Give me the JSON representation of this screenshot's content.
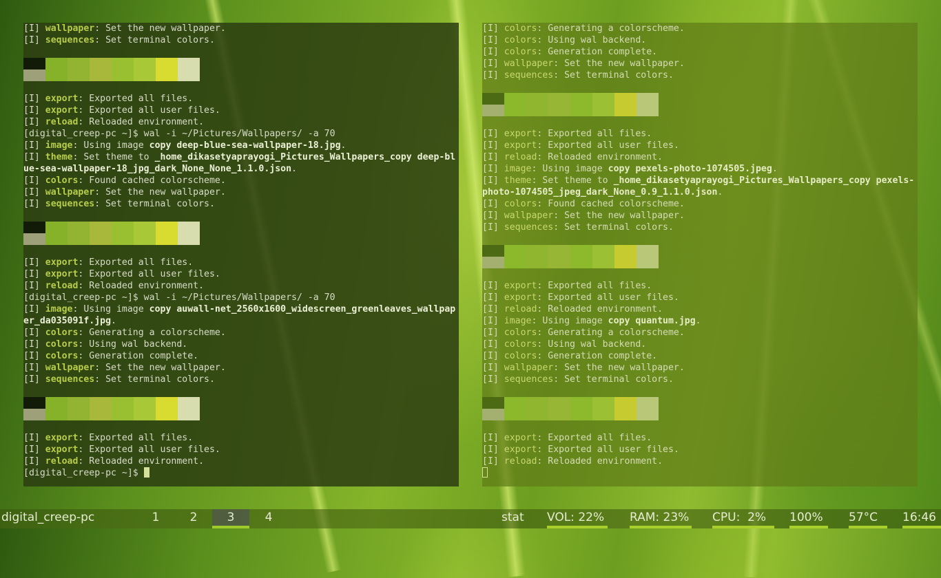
{
  "colors": {
    "accent": "#b8cd4a",
    "workspace_active_underline": "#9ecb2a",
    "stat_underline": "#a8cf2c"
  },
  "terminal_left": {
    "lines": [
      {
        "t": "line",
        "segs": [
          [
            "[I] ",
            ""
          ],
          [
            "wallpaper",
            "tag"
          ],
          [
            ": Set the new wallpaper.",
            ""
          ]
        ]
      },
      {
        "t": "line",
        "segs": [
          [
            "[I] ",
            ""
          ],
          [
            "sequences",
            "tag"
          ],
          [
            ": Set terminal colors.",
            ""
          ]
        ]
      },
      {
        "t": "blank"
      },
      {
        "t": "palette",
        "top": [
          "#121a08",
          "#86b22a",
          "#92b432",
          "#a8b83a",
          "#98c030",
          "#a8c838",
          "#d8dc30",
          "#d8ddb0"
        ],
        "bottom": [
          "#9ea07a",
          "#86b22a",
          "#92b432",
          "#a8b83a",
          "#98c030",
          "#a8c838",
          "#d8dc30",
          "#d8ddb0"
        ]
      },
      {
        "t": "blank"
      },
      {
        "t": "line",
        "segs": [
          [
            "[I] ",
            ""
          ],
          [
            "export",
            "tag"
          ],
          [
            ": Exported all files.",
            ""
          ]
        ]
      },
      {
        "t": "line",
        "segs": [
          [
            "[I] ",
            ""
          ],
          [
            "export",
            "tag"
          ],
          [
            ": Exported all user files.",
            ""
          ]
        ]
      },
      {
        "t": "line",
        "segs": [
          [
            "[I] ",
            ""
          ],
          [
            "reload",
            "tag"
          ],
          [
            ": Reloaded environment.",
            ""
          ]
        ]
      },
      {
        "t": "line",
        "segs": [
          [
            "[digital_creep-pc ~]$ wal -i ~/Pictures/Wallpapers/ -a 70",
            ""
          ]
        ]
      },
      {
        "t": "line",
        "segs": [
          [
            "[I] ",
            ""
          ],
          [
            "image",
            "tag"
          ],
          [
            ": Using image ",
            ""
          ],
          [
            "copy deep-blue-sea-wallpaper-18.jpg",
            "strong"
          ],
          [
            ".",
            ""
          ]
        ]
      },
      {
        "t": "line",
        "segs": [
          [
            "[I] ",
            ""
          ],
          [
            "theme",
            "tag"
          ],
          [
            ": Set theme to ",
            ""
          ],
          [
            "_home_dikasetyaprayogi_Pictures_Wallpapers_copy deep-bl",
            "strong"
          ]
        ]
      },
      {
        "t": "line",
        "segs": [
          [
            "ue-sea-wallpaper-18_jpg_dark_None_None_1.1.0.json",
            "strong"
          ],
          [
            ".",
            ""
          ]
        ]
      },
      {
        "t": "line",
        "segs": [
          [
            "[I] ",
            ""
          ],
          [
            "colors",
            "tag"
          ],
          [
            ": Found cached colorscheme.",
            ""
          ]
        ]
      },
      {
        "t": "line",
        "segs": [
          [
            "[I] ",
            ""
          ],
          [
            "wallpaper",
            "tag"
          ],
          [
            ": Set the new wallpaper.",
            ""
          ]
        ]
      },
      {
        "t": "line",
        "segs": [
          [
            "[I] ",
            ""
          ],
          [
            "sequences",
            "tag"
          ],
          [
            ": Set terminal colors.",
            ""
          ]
        ]
      },
      {
        "t": "blank"
      },
      {
        "t": "palette",
        "top": [
          "#121a08",
          "#86b22a",
          "#92b432",
          "#a8b83a",
          "#98c030",
          "#a8c838",
          "#d8dc30",
          "#d8ddb0"
        ],
        "bottom": [
          "#9ea07a",
          "#86b22a",
          "#92b432",
          "#a8b83a",
          "#98c030",
          "#a8c838",
          "#d8dc30",
          "#d8ddb0"
        ]
      },
      {
        "t": "blank"
      },
      {
        "t": "line",
        "segs": [
          [
            "[I] ",
            ""
          ],
          [
            "export",
            "tag"
          ],
          [
            ": Exported all files.",
            ""
          ]
        ]
      },
      {
        "t": "line",
        "segs": [
          [
            "[I] ",
            ""
          ],
          [
            "export",
            "tag"
          ],
          [
            ": Exported all user files.",
            ""
          ]
        ]
      },
      {
        "t": "line",
        "segs": [
          [
            "[I] ",
            ""
          ],
          [
            "reload",
            "tag"
          ],
          [
            ": Reloaded environment.",
            ""
          ]
        ]
      },
      {
        "t": "line",
        "segs": [
          [
            "[digital_creep-pc ~]$ wal -i ~/Pictures/Wallpapers/ -a 70",
            ""
          ]
        ]
      },
      {
        "t": "line",
        "segs": [
          [
            "[I] ",
            ""
          ],
          [
            "image",
            "tag"
          ],
          [
            ": Using image ",
            ""
          ],
          [
            "copy auwall-net_2560x1600_widescreen_greenleaves_wallpap",
            "strong"
          ]
        ]
      },
      {
        "t": "line",
        "segs": [
          [
            "er_da035091f.jpg",
            "strong"
          ],
          [
            ".",
            ""
          ]
        ]
      },
      {
        "t": "line",
        "segs": [
          [
            "[I] ",
            ""
          ],
          [
            "colors",
            "tag"
          ],
          [
            ": Generating a colorscheme.",
            ""
          ]
        ]
      },
      {
        "t": "line",
        "segs": [
          [
            "[I] ",
            ""
          ],
          [
            "colors",
            "tag"
          ],
          [
            ": Using wal backend.",
            ""
          ]
        ]
      },
      {
        "t": "line",
        "segs": [
          [
            "[I] ",
            ""
          ],
          [
            "colors",
            "tag"
          ],
          [
            ": Generation complete.",
            ""
          ]
        ]
      },
      {
        "t": "line",
        "segs": [
          [
            "[I] ",
            ""
          ],
          [
            "wallpaper",
            "tag"
          ],
          [
            ": Set the new wallpaper.",
            ""
          ]
        ]
      },
      {
        "t": "line",
        "segs": [
          [
            "[I] ",
            ""
          ],
          [
            "sequences",
            "tag"
          ],
          [
            ": Set terminal colors.",
            ""
          ]
        ]
      },
      {
        "t": "blank"
      },
      {
        "t": "palette",
        "top": [
          "#121a08",
          "#86b22a",
          "#92b432",
          "#a8b83a",
          "#98c030",
          "#a8c838",
          "#d8dc30",
          "#d8ddb0"
        ],
        "bottom": [
          "#9ea07a",
          "#86b22a",
          "#92b432",
          "#a8b83a",
          "#98c030",
          "#a8c838",
          "#d8dc30",
          "#d8ddb0"
        ]
      },
      {
        "t": "blank"
      },
      {
        "t": "line",
        "segs": [
          [
            "[I] ",
            ""
          ],
          [
            "export",
            "tag"
          ],
          [
            ": Exported all files.",
            ""
          ]
        ]
      },
      {
        "t": "line",
        "segs": [
          [
            "[I] ",
            ""
          ],
          [
            "export",
            "tag"
          ],
          [
            ": Exported all user files.",
            ""
          ]
        ]
      },
      {
        "t": "line",
        "segs": [
          [
            "[I] ",
            ""
          ],
          [
            "reload",
            "tag"
          ],
          [
            ": Reloaded environment.",
            ""
          ]
        ]
      },
      {
        "t": "prompt",
        "segs": [
          [
            "[digital_creep-pc ~]$ ",
            ""
          ]
        ],
        "cursor": "solid"
      }
    ]
  },
  "terminal_right": {
    "lines": [
      {
        "t": "line",
        "segs": [
          [
            "[I] ",
            ""
          ],
          [
            "colors",
            "tag"
          ],
          [
            ": Generating a colorscheme.",
            ""
          ]
        ]
      },
      {
        "t": "line",
        "segs": [
          [
            "[I] ",
            ""
          ],
          [
            "colors",
            "tag"
          ],
          [
            ": Using wal backend.",
            ""
          ]
        ]
      },
      {
        "t": "line",
        "segs": [
          [
            "[I] ",
            ""
          ],
          [
            "colors",
            "tag"
          ],
          [
            ": Generation complete.",
            ""
          ]
        ]
      },
      {
        "t": "line",
        "segs": [
          [
            "[I] ",
            ""
          ],
          [
            "wallpaper",
            "tag"
          ],
          [
            ": Set the new wallpaper.",
            ""
          ]
        ]
      },
      {
        "t": "line",
        "segs": [
          [
            "[I] ",
            ""
          ],
          [
            "sequences",
            "tag"
          ],
          [
            ": Set terminal colors.",
            ""
          ]
        ]
      },
      {
        "t": "blank"
      },
      {
        "t": "palette",
        "top": [
          "#4c6a14",
          "#8cb82c",
          "#90b630",
          "#98b636",
          "#8cba2c",
          "#9cc034",
          "#c6cc30",
          "#b8c878"
        ],
        "bottom": [
          "#a4b070",
          "#8cb82c",
          "#90b630",
          "#98b636",
          "#8cba2c",
          "#9cc034",
          "#c6cc30",
          "#b8c878"
        ]
      },
      {
        "t": "blank"
      },
      {
        "t": "line",
        "segs": [
          [
            "[I] ",
            ""
          ],
          [
            "export",
            "tag"
          ],
          [
            ": Exported all files.",
            ""
          ]
        ]
      },
      {
        "t": "line",
        "segs": [
          [
            "[I] ",
            ""
          ],
          [
            "export",
            "tag"
          ],
          [
            ": Exported all user files.",
            ""
          ]
        ]
      },
      {
        "t": "line",
        "segs": [
          [
            "[I] ",
            ""
          ],
          [
            "reload",
            "tag"
          ],
          [
            ": Reloaded environment.",
            ""
          ]
        ]
      },
      {
        "t": "line",
        "segs": [
          [
            "[I] ",
            ""
          ],
          [
            "image",
            "tag"
          ],
          [
            ": Using image ",
            ""
          ],
          [
            "copy pexels-photo-1074505.jpeg",
            "strong"
          ],
          [
            ".",
            ""
          ]
        ]
      },
      {
        "t": "line",
        "segs": [
          [
            "[I] ",
            ""
          ],
          [
            "theme",
            "tag"
          ],
          [
            ": Set theme to ",
            ""
          ],
          [
            "_home_dikasetyaprayogi_Pictures_Wallpapers_copy pexels-",
            "strong"
          ]
        ]
      },
      {
        "t": "line",
        "segs": [
          [
            "photo-1074505_jpeg_dark_None_0.9_1.1.0.json",
            "strong"
          ],
          [
            ".",
            ""
          ]
        ]
      },
      {
        "t": "line",
        "segs": [
          [
            "[I] ",
            ""
          ],
          [
            "colors",
            "tag"
          ],
          [
            ": Found cached colorscheme.",
            ""
          ]
        ]
      },
      {
        "t": "line",
        "segs": [
          [
            "[I] ",
            ""
          ],
          [
            "wallpaper",
            "tag"
          ],
          [
            ": Set the new wallpaper.",
            ""
          ]
        ]
      },
      {
        "t": "line",
        "segs": [
          [
            "[I] ",
            ""
          ],
          [
            "sequences",
            "tag"
          ],
          [
            ": Set terminal colors.",
            ""
          ]
        ]
      },
      {
        "t": "blank"
      },
      {
        "t": "palette",
        "top": [
          "#4c6a14",
          "#8cb82c",
          "#90b630",
          "#98b636",
          "#8cba2c",
          "#9cc034",
          "#c6cc30",
          "#b8c878"
        ],
        "bottom": [
          "#a4b070",
          "#8cb82c",
          "#90b630",
          "#98b636",
          "#8cba2c",
          "#9cc034",
          "#c6cc30",
          "#b8c878"
        ]
      },
      {
        "t": "blank"
      },
      {
        "t": "line",
        "segs": [
          [
            "[I] ",
            ""
          ],
          [
            "export",
            "tag"
          ],
          [
            ": Exported all files.",
            ""
          ]
        ]
      },
      {
        "t": "line",
        "segs": [
          [
            "[I] ",
            ""
          ],
          [
            "export",
            "tag"
          ],
          [
            ": Exported all user files.",
            ""
          ]
        ]
      },
      {
        "t": "line",
        "segs": [
          [
            "[I] ",
            ""
          ],
          [
            "reload",
            "tag"
          ],
          [
            ": Reloaded environment.",
            ""
          ]
        ]
      },
      {
        "t": "line",
        "segs": [
          [
            "[I] ",
            ""
          ],
          [
            "image",
            "tag"
          ],
          [
            ": Using image ",
            ""
          ],
          [
            "copy quantum.jpg",
            "strong"
          ],
          [
            ".",
            ""
          ]
        ]
      },
      {
        "t": "line",
        "segs": [
          [
            "[I] ",
            ""
          ],
          [
            "colors",
            "tag"
          ],
          [
            ": Generating a colorscheme.",
            ""
          ]
        ]
      },
      {
        "t": "line",
        "segs": [
          [
            "[I] ",
            ""
          ],
          [
            "colors",
            "tag"
          ],
          [
            ": Using wal backend.",
            ""
          ]
        ]
      },
      {
        "t": "line",
        "segs": [
          [
            "[I] ",
            ""
          ],
          [
            "colors",
            "tag"
          ],
          [
            ": Generation complete.",
            ""
          ]
        ]
      },
      {
        "t": "line",
        "segs": [
          [
            "[I] ",
            ""
          ],
          [
            "wallpaper",
            "tag"
          ],
          [
            ": Set the new wallpaper.",
            ""
          ]
        ]
      },
      {
        "t": "line",
        "segs": [
          [
            "[I] ",
            ""
          ],
          [
            "sequences",
            "tag"
          ],
          [
            ": Set terminal colors.",
            ""
          ]
        ]
      },
      {
        "t": "blank"
      },
      {
        "t": "palette",
        "top": [
          "#4c6a14",
          "#8cb82c",
          "#90b630",
          "#98b636",
          "#8cba2c",
          "#9cc034",
          "#c6cc30",
          "#b8c878"
        ],
        "bottom": [
          "#a4b070",
          "#8cb82c",
          "#90b630",
          "#98b636",
          "#8cba2c",
          "#9cc034",
          "#c6cc30",
          "#b8c878"
        ]
      },
      {
        "t": "blank"
      },
      {
        "t": "line",
        "segs": [
          [
            "[I] ",
            ""
          ],
          [
            "export",
            "tag"
          ],
          [
            ": Exported all files.",
            ""
          ]
        ]
      },
      {
        "t": "line",
        "segs": [
          [
            "[I] ",
            ""
          ],
          [
            "export",
            "tag"
          ],
          [
            ": Exported all user files.",
            ""
          ]
        ]
      },
      {
        "t": "line",
        "segs": [
          [
            "[I] ",
            ""
          ],
          [
            "reload",
            "tag"
          ],
          [
            ": Reloaded environment.",
            ""
          ]
        ]
      },
      {
        "t": "prompt",
        "segs": [],
        "cursor": "hollow"
      }
    ]
  },
  "statusbar": {
    "hostname": "digital_creep-pc",
    "workspaces": [
      {
        "label": "1",
        "active": false
      },
      {
        "label": "2",
        "active": false
      },
      {
        "label": "3",
        "active": true
      },
      {
        "label": "4",
        "active": false
      }
    ],
    "stats": [
      {
        "label": "stat",
        "underline": false
      },
      {
        "label": "VOL: 22%",
        "underline": true
      },
      {
        "label": "RAM: 23%",
        "underline": true
      },
      {
        "label": "CPU:  2%",
        "underline": true
      },
      {
        "label": "100%",
        "underline": true
      },
      {
        "label": "57°C",
        "underline": true
      },
      {
        "label": "16:46",
        "underline": true
      }
    ]
  }
}
